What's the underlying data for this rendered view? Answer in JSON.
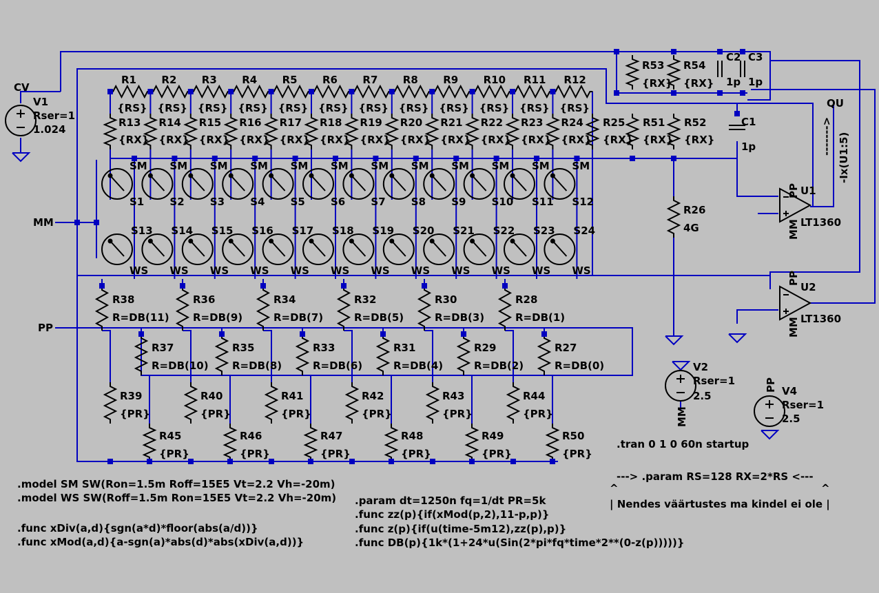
{
  "colors": {
    "background": "#c0c0c0",
    "wire": "#0000c0",
    "component": "#000000",
    "label_text": "#000000",
    "annotation": "#0000c0"
  },
  "net_labels": {
    "cv": "CV",
    "mm": "MM",
    "pp": "PP",
    "qu": "QU"
  },
  "top_resistors": [
    "R1",
    "R2",
    "R3",
    "R4",
    "R5",
    "R6",
    "R7",
    "R8",
    "R9",
    "R10",
    "R11",
    "R12"
  ],
  "top_values": [
    "{RS}",
    "{RS}",
    "{RS}",
    "{RS}",
    "{RS}",
    "{RS}",
    "{RS}",
    "{RS}",
    "{RS}",
    "{RS}",
    "{RS}",
    "{RS}"
  ],
  "mid_resistors": [
    "R13",
    "R14",
    "R15",
    "R16",
    "R17",
    "R18",
    "R19",
    "R20",
    "R21",
    "R22",
    "R23",
    "R24",
    "R25",
    "R51",
    "R52"
  ],
  "mid_values": [
    "{RX}",
    "{RX}",
    "{RX}",
    "{RX}",
    "{RX}",
    "{RX}",
    "{RX}",
    "{RX}",
    "{RX}",
    "{RX}",
    "{RX}",
    "{RX}",
    "{RX}",
    "{RX}",
    "{RX}"
  ],
  "switches_top": [
    "S1",
    "S2",
    "S3",
    "S4",
    "S5",
    "S6",
    "S7",
    "S8",
    "S9",
    "S10",
    "S11",
    "S12"
  ],
  "switches_bottom": [
    "S13",
    "S14",
    "S15",
    "S16",
    "S17",
    "S18",
    "S19",
    "S20",
    "S21",
    "S22",
    "S23",
    "S24"
  ],
  "sm_model": "SM",
  "ws_model": "WS",
  "feedback": {
    "r53": "R53",
    "r53_value": "{RX}",
    "r54": "R54",
    "r54_value": "{RX}",
    "c2": "C2",
    "c2_value": "1p",
    "c3": "C3",
    "c3_value": "1p"
  },
  "c1": {
    "name": "C1",
    "value": "1p"
  },
  "r26": {
    "name": "R26",
    "value": "4G"
  },
  "u1": {
    "name": "U1",
    "part": "LT1360",
    "pp": "PP",
    "mm": "MM"
  },
  "u2": {
    "name": "U2",
    "part": "LT1360",
    "pp": "PP",
    "mm": "MM"
  },
  "probe_label": "-Ix(U1:5)",
  "probe_arrow": "------->",
  "v1": {
    "name": "V1",
    "rser": "Rser=1",
    "value": "1.024"
  },
  "v2": {
    "name": "V2",
    "rser": "Rser=1",
    "value": "2.5",
    "net": "MM"
  },
  "v4": {
    "name": "V4",
    "rser": "Rser=1",
    "value": "2.5",
    "net": "PP"
  },
  "db_names_top": [
    "R38",
    "R36",
    "R34",
    "R32",
    "R30",
    "R28"
  ],
  "db_values_top": [
    "R=DB(11)",
    "R=DB(9)",
    "R=DB(7)",
    "R=DB(5)",
    "R=DB(3)",
    "R=DB(1)"
  ],
  "db_names_bottom": [
    "R37",
    "R35",
    "R33",
    "R31",
    "R29",
    "R27"
  ],
  "db_values_bottom": [
    "R=DB(10)",
    "R=DB(8)",
    "R=DB(6)",
    "R=DB(4)",
    "R=DB(2)",
    "R=DB(0)"
  ],
  "pr_names_top": [
    "R39",
    "R40",
    "R41",
    "R42",
    "R43",
    "R44"
  ],
  "pr_names_bottom": [
    "R45",
    "R46",
    "R47",
    "R48",
    "R49",
    "R50"
  ],
  "pr_value": "{PR}",
  "directives": {
    "tran": ".tran 0 1 0 60n startup",
    "param_rs": "--->  .param RS=128 RX=2*RS  <---",
    "caret": "^",
    "note": "| Nendes väärtustes ma kindel ei ole |",
    "model_sm": ".model SM SW(Ron=1.5m Roff=15E5 Vt=2.2 Vh=-20m)",
    "model_ws": ".model WS SW(Roff=1.5m Ron=15E5 Vt=2.2 Vh=-20m)",
    "func_xdiv": ".func xDiv(a,d){sgn(a*d)*floor(abs(a/d))}",
    "func_xmod": ".func xMod(a,d){a-sgn(a)*abs(d)*abs(xDiv(a,d))}",
    "param_dt": ".param dt=1250n fq=1/dt PR=5k",
    "func_zz": ".func zz(p){if(xMod(p,2),11-p,p)}",
    "func_z": ".func z(p){if(u(time-5m12),zz(p),p)}",
    "func_db": ".func DB(p){1k*(1+24*u(Sin(2*pi*fq*time*2**(0-z(p)))))}"
  }
}
